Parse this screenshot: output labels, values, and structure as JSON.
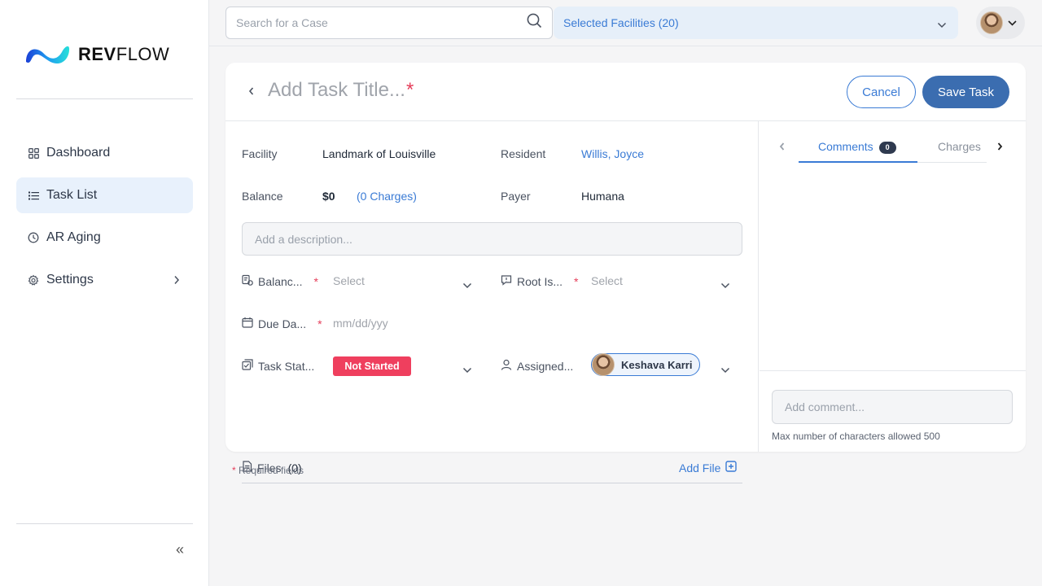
{
  "brand": {
    "name_bold": "REV",
    "name_rest": "FLOW"
  },
  "sidebar": {
    "items": [
      {
        "label": "Dashboard",
        "icon": "grid-icon",
        "active": false
      },
      {
        "label": "Task List",
        "icon": "list-icon",
        "active": true
      },
      {
        "label": "AR Aging",
        "icon": "clock-icon",
        "active": false
      },
      {
        "label": "Settings",
        "icon": "gear-icon",
        "active": false
      }
    ],
    "collapse_icon": "«"
  },
  "topbar": {
    "search_placeholder": "Search for a Case",
    "facilities_label": "Selected Facilities (20)"
  },
  "task": {
    "title_placeholder": "Add Task Title...",
    "required_mark": "*",
    "cancel_label": "Cancel",
    "save_label": "Save Task",
    "facility_label": "Facility",
    "facility_value": "Landmark of Louisville",
    "resident_label": "Resident",
    "resident_value": "Willis, Joyce",
    "balance_label": "Balance",
    "balance_value": "$0",
    "charges_link": "(0 Charges)",
    "payer_label": "Payer",
    "payer_value": "Humana",
    "description_placeholder": "Add a description...",
    "balance_type_label": "Balanc...",
    "balance_type_value": "Select",
    "root_issue_label": "Root Is...",
    "root_issue_value": "Select",
    "due_date_label": "Due Da...",
    "due_date_placeholder": "mm/dd/yyy",
    "status_label": "Task Stat...",
    "status_value": "Not Started",
    "assigned_label": "Assigned...",
    "assigned_value": "Keshava Karri",
    "files_label": "Files",
    "files_count": "(0)",
    "add_file_label": "Add File"
  },
  "comments_panel": {
    "tab_comments": "Comments",
    "comments_count": "0",
    "tab_charges": "Charges",
    "comment_placeholder": "Add comment...",
    "max_chars_note": "Max number of characters allowed 500"
  },
  "footer": {
    "required_note": "Required fields",
    "required_star": "*"
  },
  "colors": {
    "accent": "#3a7bd5",
    "primary_button": "#3b6db0",
    "danger": "#ef3f5e",
    "active_nav_bg": "#e8f1fc"
  }
}
